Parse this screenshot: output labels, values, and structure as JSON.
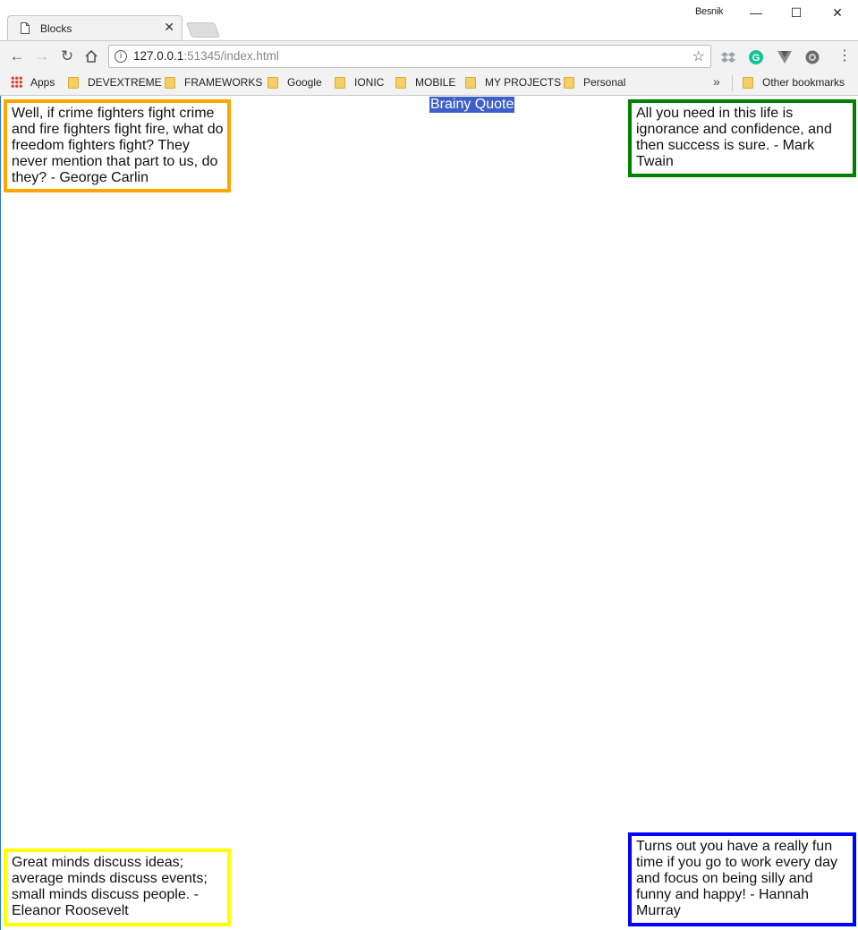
{
  "browser": {
    "tab_title": "Blocks",
    "tab_close": "✕",
    "profile_name": "Besnik",
    "window_controls": {
      "minimize": "—",
      "maximize": "☐",
      "close": "✕"
    },
    "url_host": "127.0.0.1",
    "url_rest": ":51345/index.html",
    "bookmarks": [
      {
        "label": "Apps",
        "icon": "apps-grid-icon"
      },
      {
        "label": "DEVEXTREME",
        "icon": "folder-icon"
      },
      {
        "label": "FRAMEWORKS",
        "icon": "folder-icon"
      },
      {
        "label": "Google",
        "icon": "folder-icon"
      },
      {
        "label": "IONIC",
        "icon": "folder-icon"
      },
      {
        "label": "MOBILE",
        "icon": "folder-icon"
      },
      {
        "label": "MY PROJECTS",
        "icon": "folder-icon"
      },
      {
        "label": "Personal",
        "icon": "folder-icon"
      }
    ],
    "overflow_chevron": "»",
    "other_bookmarks": "Other bookmarks",
    "extensions": [
      "dropbox-icon",
      "grammarly-icon",
      "vue-devtools-icon",
      "settings-extension-icon"
    ]
  },
  "page": {
    "heading": "Brainy Quote",
    "heading_bg": "#3d5fc7",
    "quotes": [
      {
        "text": "Well, if crime fighters fight crime and fire fighters fight fire, what do freedom fighters fight? They never mention that part to us, do they? - George Carlin",
        "border": "#ffa500"
      },
      {
        "text": "All you need in this life is ignorance and confidence, and then success is sure. - Mark Twain",
        "border": "#008000"
      },
      {
        "text": "Great minds discuss ideas; average minds discuss events; small minds discuss people. - Eleanor Roosevelt",
        "border": "#ffff00"
      },
      {
        "text": "Turns out you have a really fun time if you go to work every day and focus on being silly and funny and happy! - Hannah Murray",
        "border": "#0000ff"
      }
    ]
  }
}
